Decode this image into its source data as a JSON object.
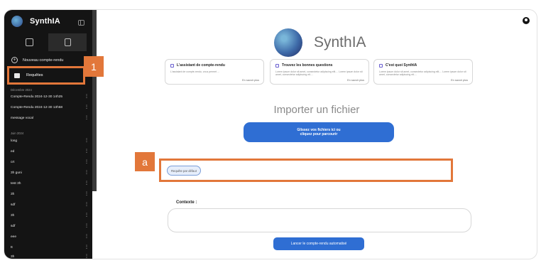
{
  "sidebar": {
    "brand": "SynthIA",
    "new_cr": "Nouveau compte-rendu",
    "requetes": "Requêtes",
    "section_dec": "Décembre 2024",
    "items_dec": [
      {
        "label": "Compte-Rendu 2024-12-30 14h25"
      },
      {
        "label": "Compte-Rendu 2024-12-30 13h58"
      },
      {
        "label": "message vocal"
      }
    ],
    "section_jun": "Juin 2024",
    "items_jun": [
      {
        "label": "long"
      },
      {
        "label": "ed"
      },
      {
        "label": "crt"
      },
      {
        "label": "3h guni"
      },
      {
        "label": "test 3h"
      },
      {
        "label": "3h"
      },
      {
        "label": "sdf"
      },
      {
        "label": "3h"
      },
      {
        "label": "sdf"
      },
      {
        "label": "eee"
      },
      {
        "label": "tt"
      },
      {
        "label": "3h"
      }
    ]
  },
  "callouts": {
    "one": "1",
    "a": "a"
  },
  "main": {
    "title": "SynthIA",
    "cards": [
      {
        "title": "L'assistant de compte-rendu",
        "text": "L'assistant de compte-rendu, vous permet ...",
        "more": "En savoir plus"
      },
      {
        "title": "Trouvez les bonnes questions",
        "text": "Lorem ipsum dolor sit amet, consectetur adipiscing elit.... Lorem ipsum dolor sit amet, consectetur adipiscing elt....",
        "more": "En savoir plus"
      },
      {
        "title": "C'est quoi SynthIA",
        "text": "Lorem ipsum dolor sit amet, consectetur adipiscing elit.... Lorem ipsum dolor sit amet, consectetur adipiscing elt....",
        "more": "En savoir plus"
      }
    ],
    "import_title": "Importer un fichier",
    "dropzone_l1": "Glissez vos fichiers ici ou",
    "dropzone_l2": "cliquez pour parcourir",
    "default_request": "Requête par défaut",
    "contexte_label": "Contexte :",
    "launch": "Lancer le compte-rendu automatisé"
  },
  "colors": {
    "accent": "#2f6ed3",
    "highlight": "#e2773a",
    "sidebar": "#141414"
  }
}
